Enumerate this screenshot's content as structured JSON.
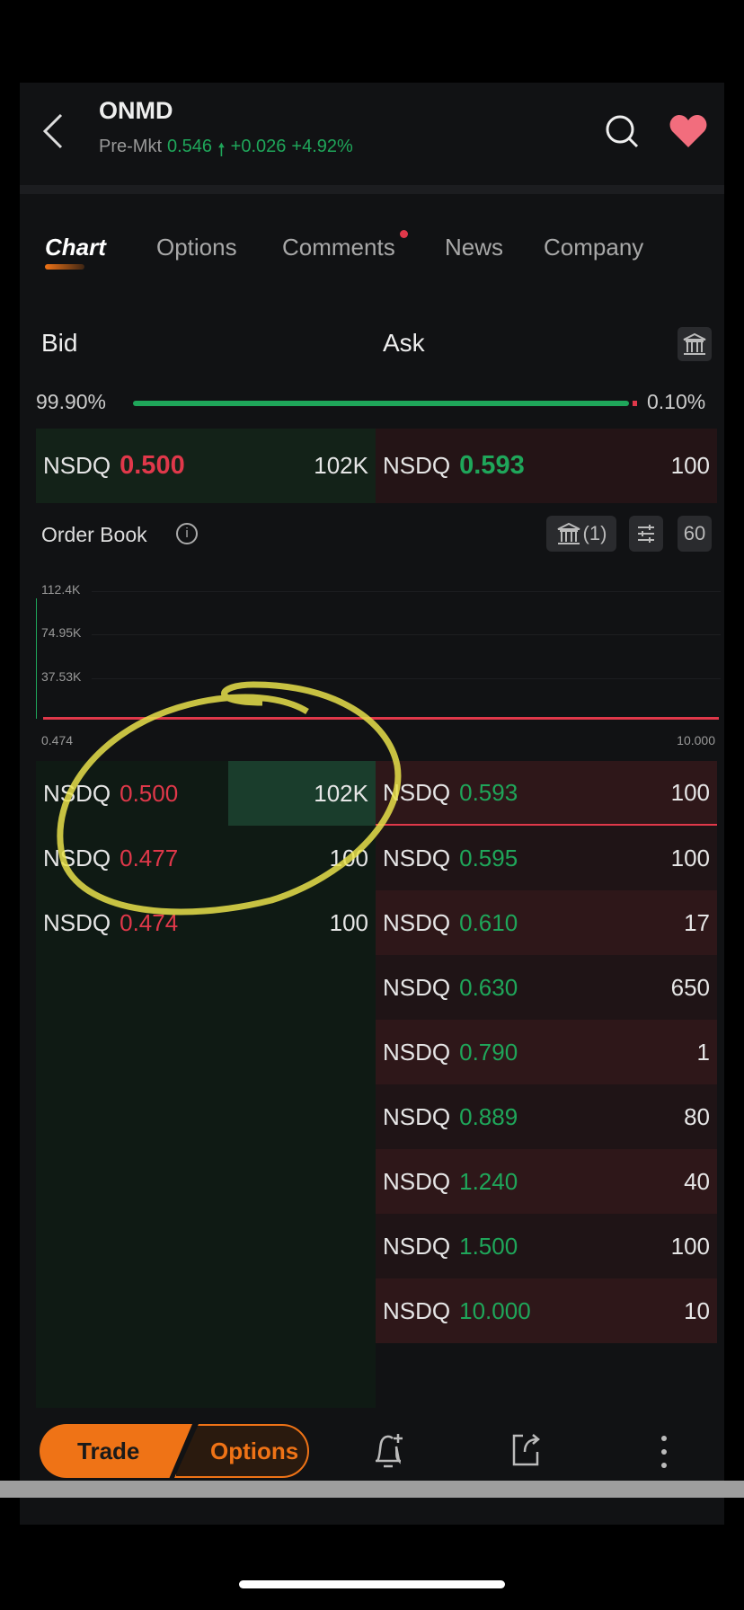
{
  "header": {
    "ticker": "ONMD",
    "session": "Pre-Mkt",
    "price": "0.546",
    "change": "+0.026",
    "change_pct": "+4.92%"
  },
  "tabs": [
    {
      "label": "Chart",
      "active": true
    },
    {
      "label": "Options"
    },
    {
      "label": "Comments",
      "badge": true
    },
    {
      "label": "News"
    },
    {
      "label": "Company"
    }
  ],
  "quote": {
    "bid_label": "Bid",
    "ask_label": "Ask",
    "bid_pct": "99.90%",
    "ask_pct": "0.10%",
    "bid_fraction": 0.999,
    "best_bid": {
      "exchange": "NSDQ",
      "price": "0.500",
      "size": "102K"
    },
    "best_ask": {
      "exchange": "NSDQ",
      "price": "0.593",
      "size": "100"
    }
  },
  "order_book": {
    "title": "Order Book",
    "broker_count": "(1)",
    "depth": "60",
    "chart": {
      "y_ticks": [
        "112.4K",
        "74.95K",
        "37.53K"
      ],
      "x_min": "0.474",
      "x_max": "10.000"
    },
    "bids": [
      {
        "exchange": "NSDQ",
        "price": "0.500",
        "size": "102K"
      },
      {
        "exchange": "NSDQ",
        "price": "0.477",
        "size": "100"
      },
      {
        "exchange": "NSDQ",
        "price": "0.474",
        "size": "100"
      }
    ],
    "asks": [
      {
        "exchange": "NSDQ",
        "price": "0.593",
        "size": "100"
      },
      {
        "exchange": "NSDQ",
        "price": "0.595",
        "size": "100"
      },
      {
        "exchange": "NSDQ",
        "price": "0.610",
        "size": "17"
      },
      {
        "exchange": "NSDQ",
        "price": "0.630",
        "size": "650"
      },
      {
        "exchange": "NSDQ",
        "price": "0.790",
        "size": "1"
      },
      {
        "exchange": "NSDQ",
        "price": "0.889",
        "size": "80"
      },
      {
        "exchange": "NSDQ",
        "price": "1.240",
        "size": "40"
      },
      {
        "exchange": "NSDQ",
        "price": "1.500",
        "size": "100"
      },
      {
        "exchange": "NSDQ",
        "price": "10.000",
        "size": "10"
      }
    ]
  },
  "bottom": {
    "trade_label": "Trade",
    "options_label": "Options"
  },
  "colors": {
    "up": "#1fa65a",
    "down": "#e0384a",
    "accent": "#ef7316",
    "favorite": "#f26d7d"
  }
}
